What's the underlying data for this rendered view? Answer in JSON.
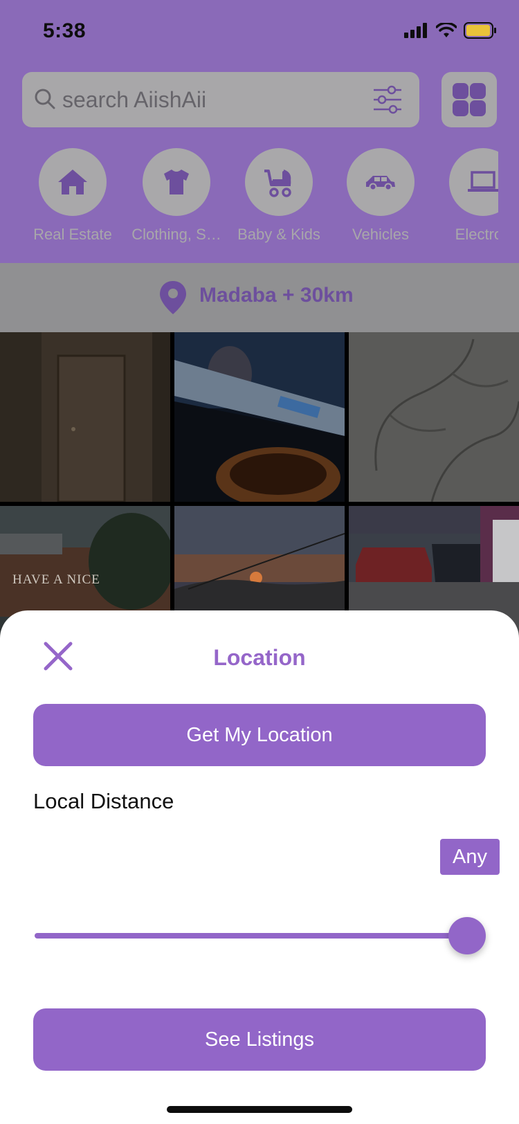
{
  "status": {
    "time": "5:38"
  },
  "search": {
    "placeholder": "search AiishAii"
  },
  "categories": [
    {
      "label": "Real Estate",
      "icon": "house-icon"
    },
    {
      "label": "Clothing, S…",
      "icon": "tshirt-icon"
    },
    {
      "label": "Baby & Kids",
      "icon": "stroller-icon"
    },
    {
      "label": "Vehicles",
      "icon": "car-icon"
    },
    {
      "label": "Electron",
      "icon": "laptop-icon"
    }
  ],
  "location_bar": {
    "text": "Madaba + 30km"
  },
  "photos": [
    {
      "caption": ""
    },
    {
      "caption": ""
    },
    {
      "caption": ""
    },
    {
      "caption": "HAVE A NICE"
    },
    {
      "caption": ""
    },
    {
      "caption": ""
    }
  ],
  "sheet": {
    "title": "Location",
    "get_location_label": "Get My Location",
    "distance_label": "Local Distance",
    "distance_value": "Any",
    "slider_value_percent": 100,
    "see_listings_label": "See Listings"
  },
  "colors": {
    "accent": "#9266c8",
    "header_dimmed": "#8a6ab8",
    "sheet_bg": "#ffffff"
  }
}
